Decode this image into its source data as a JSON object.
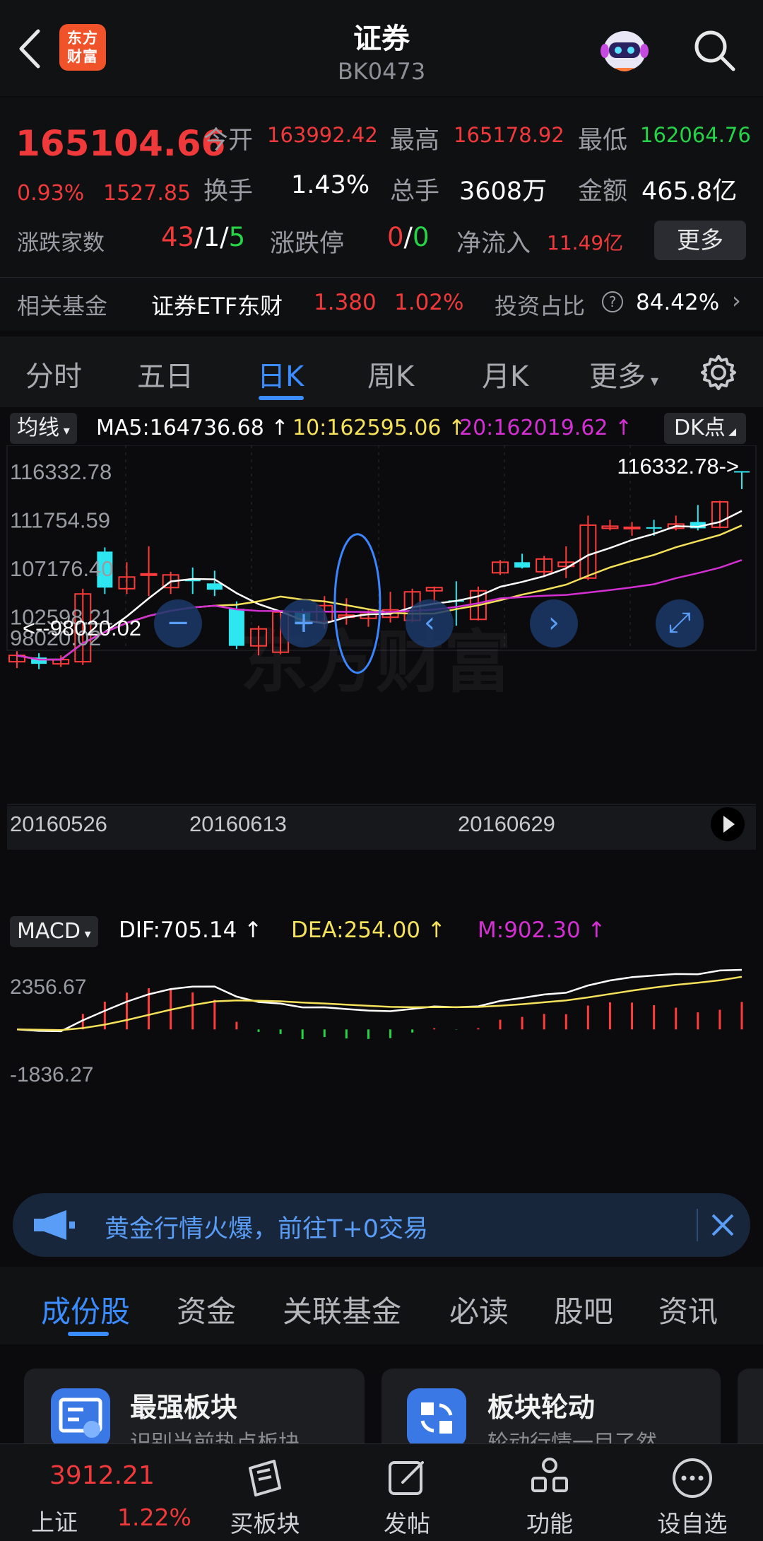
{
  "header": {
    "logo_text": "东方\n财富",
    "title": "证券",
    "code": "BK0473"
  },
  "quote": {
    "price": "165104.66",
    "change_pct": "0.93%",
    "change_abs": "1527.85",
    "open_label": "今开",
    "open": "163992.42",
    "high_label": "最高",
    "high": "165178.92",
    "low_label": "最低",
    "low": "162064.76",
    "turnover_label": "换手",
    "turnover": "1.43%",
    "volume_label": "总手",
    "volume": "3608万",
    "amount_label": "金额",
    "amount": "465.8亿",
    "breadth_label": "涨跌家数",
    "breadth_up": "43",
    "breadth_flat": "1",
    "breadth_down": "5",
    "limit_label": "涨跌停",
    "limit_up": "0",
    "limit_down": "0",
    "inflow_label": "净流入",
    "inflow": "11.49亿",
    "more_label": "更多",
    "fund_label": "相关基金",
    "fund_name": "证券ETF东财",
    "fund_price": "1.380",
    "fund_pct": "1.02%",
    "ratio_label": "投资占比",
    "ratio_value": "84.42%"
  },
  "period_tabs": [
    "分时",
    "五日",
    "日K",
    "周K",
    "月K",
    "更多"
  ],
  "active_period": "日K",
  "ma": {
    "chip_label": "均线",
    "ma5": "MA5:164736.68",
    "ma10": "10:162595.06",
    "ma20": "20:162019.62",
    "dk_label": "DK点",
    "colors": {
      "ma5": "#ffffff",
      "ma10": "#f5e15a",
      "ma20": "#d42fd3"
    }
  },
  "chart_data": {
    "type": "candlestick",
    "price_axis": [
      "116332.78",
      "111754.59",
      "107176.40",
      "102598.21",
      "98020.02"
    ],
    "ylim": [
      98020.02,
      116332.78
    ],
    "max_marker": "116332.78->",
    "min_marker": "<--98020.02",
    "candles": [
      {
        "o": 98300,
        "c": 98900,
        "h": 99300,
        "l": 97700
      },
      {
        "o": 98700,
        "c": 98100,
        "h": 99100,
        "l": 97600
      },
      {
        "o": 98100,
        "c": 98500,
        "h": 98900,
        "l": 97800
      },
      {
        "o": 98300,
        "c": 104700,
        "h": 105200,
        "l": 98000
      },
      {
        "o": 108700,
        "c": 105300,
        "h": 109100,
        "l": 104700
      },
      {
        "o": 105200,
        "c": 106300,
        "h": 107700,
        "l": 104700
      },
      {
        "o": 106500,
        "c": 106600,
        "h": 109200,
        "l": 104500
      },
      {
        "o": 105300,
        "c": 106500,
        "h": 106800,
        "l": 104700
      },
      {
        "o": 106100,
        "c": 105900,
        "h": 107200,
        "l": 104700
      },
      {
        "o": 105700,
        "c": 105100,
        "h": 106900,
        "l": 104500
      },
      {
        "o": 103300,
        "c": 99800,
        "h": 104000,
        "l": 99500
      },
      {
        "o": 99800,
        "c": 101400,
        "h": 101700,
        "l": 98900
      },
      {
        "o": 99200,
        "c": 103000,
        "h": 103100,
        "l": 99000
      },
      {
        "o": 103000,
        "c": 101800,
        "h": 103300,
        "l": 101200
      },
      {
        "o": 102100,
        "c": 103600,
        "h": 104500,
        "l": 101400
      },
      {
        "o": 102500,
        "c": 102700,
        "h": 104300,
        "l": 101800
      },
      {
        "o": 102400,
        "c": 102800,
        "h": 103300,
        "l": 101600
      },
      {
        "o": 102500,
        "c": 103200,
        "h": 104900,
        "l": 102000
      },
      {
        "o": 102200,
        "c": 104900,
        "h": 105200,
        "l": 102000
      },
      {
        "o": 105000,
        "c": 105300,
        "h": 105400,
        "l": 103800
      },
      {
        "o": 104100,
        "c": 104000,
        "h": 105900,
        "l": 101700
      },
      {
        "o": 102300,
        "c": 105000,
        "h": 105400,
        "l": 102200
      },
      {
        "o": 106700,
        "c": 107700,
        "h": 107900,
        "l": 106500
      },
      {
        "o": 107700,
        "c": 107200,
        "h": 108500,
        "l": 107100
      },
      {
        "o": 106800,
        "c": 108000,
        "h": 108300,
        "l": 106300
      },
      {
        "o": 107300,
        "c": 107700,
        "h": 109200,
        "l": 106200
      },
      {
        "o": 106200,
        "c": 111200,
        "h": 112100,
        "l": 106000
      },
      {
        "o": 110900,
        "c": 111100,
        "h": 111700,
        "l": 110700
      },
      {
        "o": 110900,
        "c": 111000,
        "h": 111500,
        "l": 110200
      },
      {
        "o": 111000,
        "c": 110900,
        "h": 111700,
        "l": 110200
      },
      {
        "o": 110900,
        "c": 111300,
        "h": 112100,
        "l": 110700
      },
      {
        "o": 111500,
        "c": 110900,
        "h": 113100,
        "l": 110700
      },
      {
        "o": 111000,
        "c": 113400,
        "h": 113500,
        "l": 110900
      },
      {
        "o": 116300,
        "c": 116200,
        "h": 116300,
        "l": 114600
      }
    ],
    "macd": {
      "label": "MACD",
      "dif": "DIF:705.14",
      "dea": "DEA:254.00",
      "m": "M:902.30",
      "axis": [
        "2356.67",
        "-1836.27"
      ],
      "ylim": [
        -1836.27,
        2356.67
      ]
    },
    "dates": [
      "20160526",
      "20160613",
      "20160629"
    ]
  },
  "chart_controls": {
    "zoom_in": "+",
    "zoom_out": "−"
  },
  "banner": {
    "text": "黄金行情火爆，前往T+0交易"
  },
  "sub_tabs": [
    "成份股",
    "资金",
    "关联基金",
    "必读",
    "股吧",
    "资讯"
  ],
  "cards": [
    {
      "title": "最强板块",
      "sub": "识别当前热点板块"
    },
    {
      "title": "板块轮动",
      "sub": "轮动行情一目了然"
    }
  ],
  "bottom_nav": {
    "index_price": "3912.21",
    "index_name": "上证",
    "index_pct": "1.22%",
    "items": [
      "买板块",
      "发帖",
      "功能",
      "设自选"
    ]
  }
}
